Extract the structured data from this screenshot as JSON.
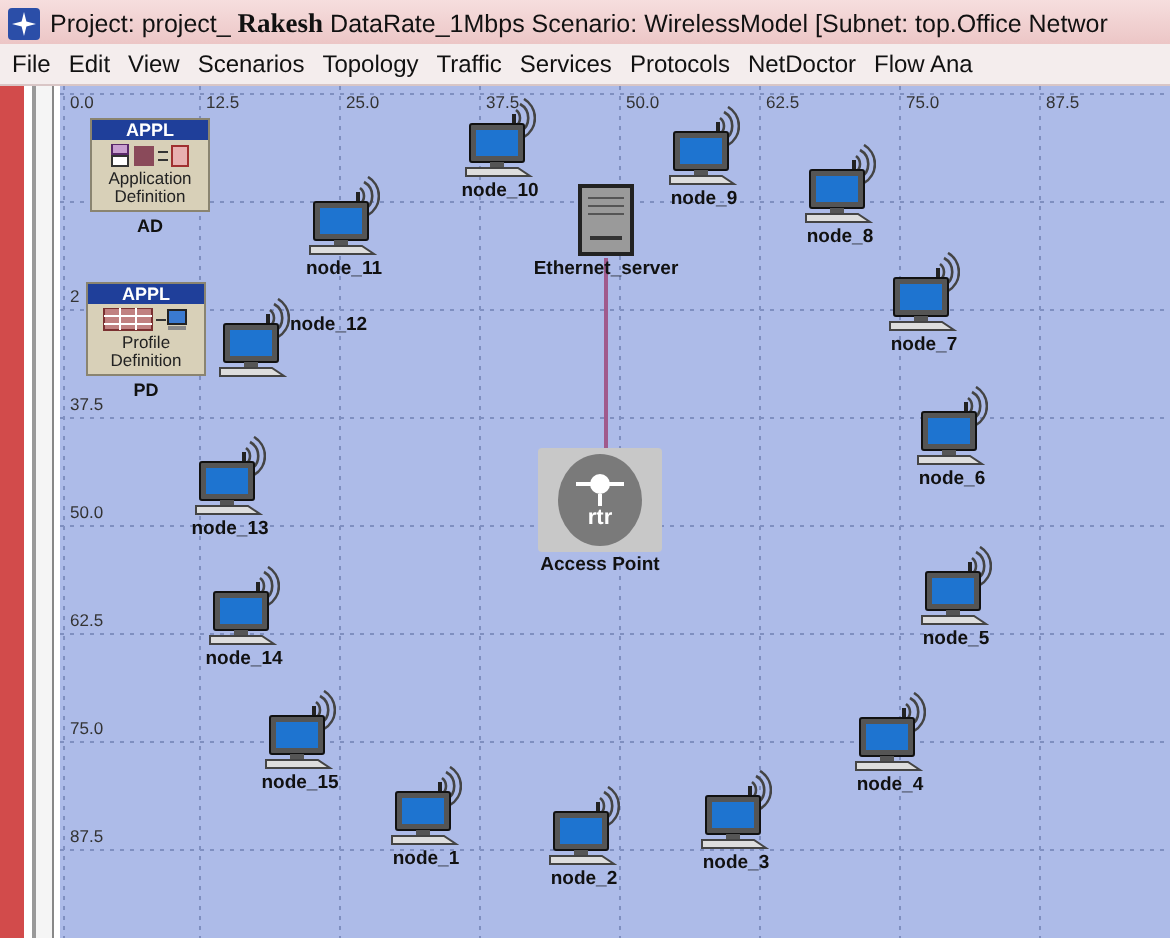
{
  "window": {
    "title": "Project: project_ **Rakesh** DataRate_1Mbps Scenario: WirelessModel  [Subnet: top.Office Networ"
  },
  "menu": [
    "File",
    "Edit",
    "View",
    "Scenarios",
    "Topology",
    "Traffic",
    "Services",
    "Protocols",
    "NetDoctor",
    "Flow Ana"
  ],
  "canvas": {
    "x_ticks": [
      "0.0",
      "12.5",
      "25.0",
      "37.5",
      "50.0",
      "62.5",
      "75.0",
      "87.5"
    ],
    "y_ticks": [
      "2",
      "37.5",
      "50.0",
      "62.5",
      "75.0",
      "87.5"
    ],
    "config_objects": [
      {
        "header": "APPL",
        "body": "Application Definition",
        "name": "AD",
        "kind": "application"
      },
      {
        "header": "APPL",
        "body": "Profile Definition",
        "name": "PD",
        "kind": "profile"
      }
    ],
    "nodes": [
      {
        "name": "node_10",
        "kind": "workstation"
      },
      {
        "name": "node_9",
        "kind": "workstation"
      },
      {
        "name": "node_8",
        "kind": "workstation"
      },
      {
        "name": "node_11",
        "kind": "workstation"
      },
      {
        "name": "Ethernet_server",
        "kind": "server"
      },
      {
        "name": "node_12",
        "kind": "workstation"
      },
      {
        "name": "node_7",
        "kind": "workstation"
      },
      {
        "name": "node_6",
        "kind": "workstation"
      },
      {
        "name": "node_13",
        "kind": "workstation"
      },
      {
        "name": "Access Point",
        "kind": "router",
        "badge": "rtr"
      },
      {
        "name": "node_14",
        "kind": "workstation"
      },
      {
        "name": "node_5",
        "kind": "workstation"
      },
      {
        "name": "node_15",
        "kind": "workstation"
      },
      {
        "name": "node_4",
        "kind": "workstation"
      },
      {
        "name": "node_1",
        "kind": "workstation"
      },
      {
        "name": "node_2",
        "kind": "workstation"
      },
      {
        "name": "node_3",
        "kind": "workstation"
      }
    ]
  }
}
